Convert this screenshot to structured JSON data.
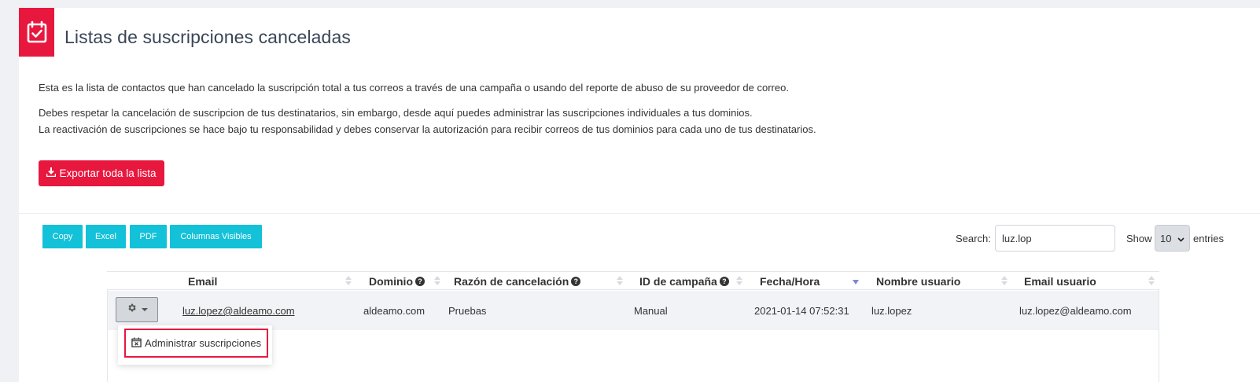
{
  "page": {
    "title": "Listas de suscripciones canceladas",
    "description_1": "Esta es la lista de contactos que han cancelado la suscripción total a tus correos a través de una campaña o usando del reporte de abuso de su proveedor de correo.",
    "description_2": "Debes respetar la cancelación de suscripcion de tus destinatarios, sin embargo, desde aquí puedes administrar las suscripciones individuales a tus dominios.",
    "description_3": "La reactivación de suscripciones se hace bajo tu responsabilidad y debes conservar la autorización para recibir correos de tus dominios para cada uno de tus destinatarios.",
    "export_label": "Exportar toda la lista",
    "icon": "calendar-check-icon",
    "accent_color": "#e8173e"
  },
  "toolbar": {
    "buttons": [
      "Copy",
      "Excel",
      "PDF",
      "Columnas Visibles"
    ],
    "button_color": "#13c1d8",
    "search_label": "Search:",
    "search_value": "luz.lop",
    "show_label": "Show",
    "page_size": "10",
    "entries_label": "entries"
  },
  "table": {
    "columns": [
      "Email",
      "Dominio",
      "Razón de cancelación",
      "ID de campaña",
      "Fecha/Hora",
      "Nombre usuario",
      "Email usuario"
    ],
    "rows": [
      {
        "email": "luz.lopez@aldeamo.com",
        "dominio": "aldeamo.com",
        "razon": "Pruebas",
        "campana": "Manual",
        "fecha": "2021-01-14 07:52:31",
        "nombre_usuario": "luz.lopez",
        "email_usuario": "luz.lopez@aldeamo.com"
      }
    ],
    "sorted_column": "Fecha/Hora",
    "sort_direction": "desc"
  },
  "dropdown": {
    "item_label": "Administrar suscripciones",
    "item_icon": "calendar-x-icon"
  }
}
